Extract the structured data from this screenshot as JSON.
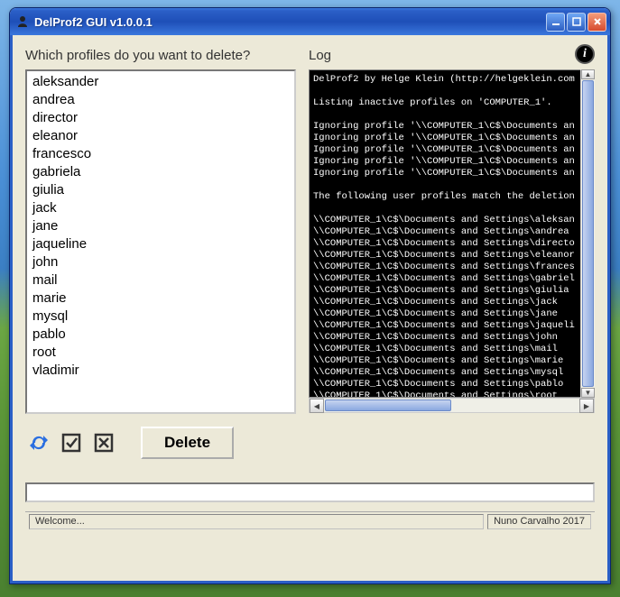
{
  "window": {
    "title": "DelProf2 GUI v1.0.0.1"
  },
  "left": {
    "label": "Which profiles do you want to delete?",
    "profiles": [
      "aleksander",
      "andrea",
      "director",
      "eleanor",
      "francesco",
      "gabriela",
      "giulia",
      "jack",
      "jane",
      "jaqueline",
      "john",
      "mail",
      "marie",
      "mysql",
      "pablo",
      "root",
      "vladimir"
    ]
  },
  "right": {
    "label": "Log",
    "log_text": "DelProf2 by Helge Klein (http://helgeklein.com\n\nListing inactive profiles on 'COMPUTER_1'.\n\nIgnoring profile '\\\\COMPUTER_1\\C$\\Documents an\nIgnoring profile '\\\\COMPUTER_1\\C$\\Documents an\nIgnoring profile '\\\\COMPUTER_1\\C$\\Documents an\nIgnoring profile '\\\\COMPUTER_1\\C$\\Documents an\nIgnoring profile '\\\\COMPUTER_1\\C$\\Documents an\n\nThe following user profiles match the deletion\n\n\\\\COMPUTER_1\\C$\\Documents and Settings\\aleksan\n\\\\COMPUTER_1\\C$\\Documents and Settings\\andrea\n\\\\COMPUTER_1\\C$\\Documents and Settings\\directo\n\\\\COMPUTER_1\\C$\\Documents and Settings\\eleanor\n\\\\COMPUTER_1\\C$\\Documents and Settings\\frances\n\\\\COMPUTER_1\\C$\\Documents and Settings\\gabriel\n\\\\COMPUTER_1\\C$\\Documents and Settings\\giulia\n\\\\COMPUTER_1\\C$\\Documents and Settings\\jack\n\\\\COMPUTER_1\\C$\\Documents and Settings\\jane\n\\\\COMPUTER_1\\C$\\Documents and Settings\\jaqueli\n\\\\COMPUTER_1\\C$\\Documents and Settings\\john\n\\\\COMPUTER_1\\C$\\Documents and Settings\\mail\n\\\\COMPUTER_1\\C$\\Documents and Settings\\marie\n\\\\COMPUTER_1\\C$\\Documents and Settings\\mysql\n\\\\COMPUTER_1\\C$\\Documents and Settings\\pablo\n\\\\COMPUTER_1\\C$\\Documents and Settings\\root\n\\\\COMPUTER_1\\C$\\Documents and Settings\\vladimi"
  },
  "toolbar": {
    "refresh_icon": "refresh",
    "select_all_icon": "select-all",
    "deselect_all_icon": "deselect-all",
    "delete_label": "Delete"
  },
  "status": {
    "left": "Welcome...",
    "right": "Nuno Carvalho 2017"
  }
}
